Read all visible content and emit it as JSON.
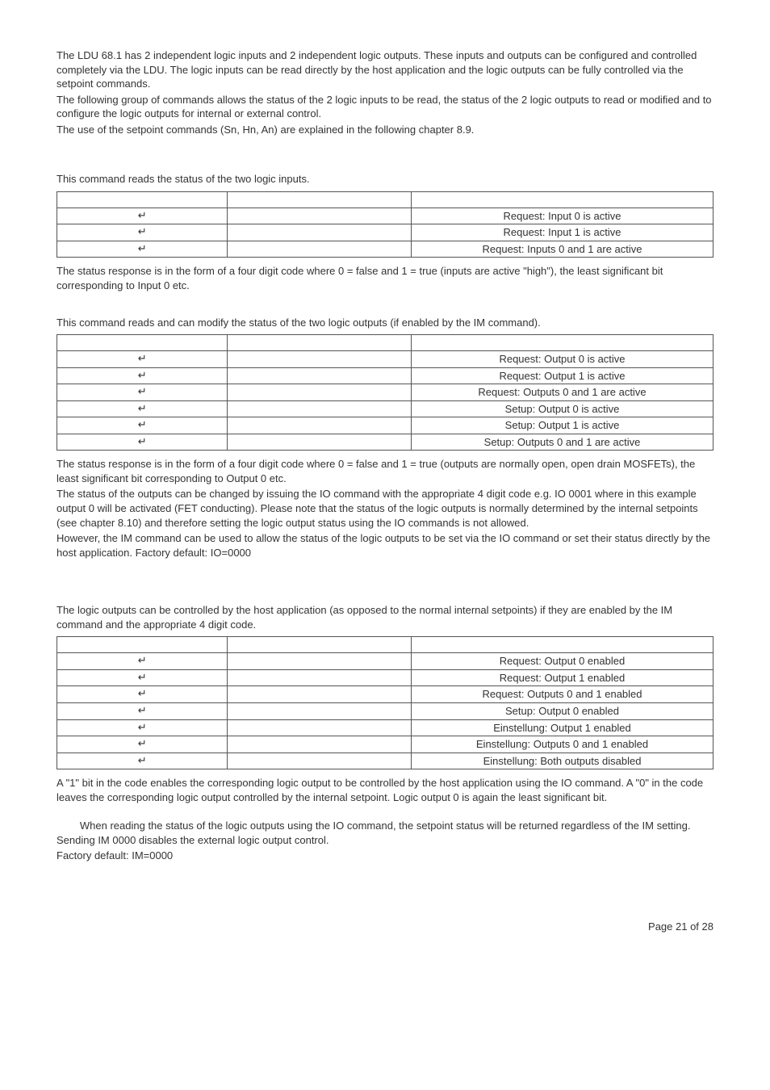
{
  "intro": {
    "p1": "The LDU 68.1 has 2 independent logic inputs and 2 independent logic outputs. These inputs and outputs can be configured and controlled completely via the LDU. The logic inputs can be read directly by the host application and the logic outputs can be fully controlled via the setpoint commands.",
    "p2": "The following group of commands allows the status of the 2 logic inputs to be read, the status of the 2 logic outputs to read or modified and to configure the logic outputs for internal or external control.",
    "p3": "The use of the setpoint commands (Sn, Hn, An) are explained in the following chapter 8.9."
  },
  "sec1": {
    "lead": "This command reads the status of the two logic inputs.",
    "rows": [
      {
        "c1": "↵",
        "c2": "",
        "c3": "Request: Input 0 is active"
      },
      {
        "c1": "↵",
        "c2": "",
        "c3": "Request: Input 1 is active"
      },
      {
        "c1": "↵",
        "c2": "",
        "c3": "Request: Inputs 0 and 1 are active"
      }
    ],
    "after": "The status response is in the form of a four digit code where 0 = false and 1 = true (inputs are active \"high\"), the least significant bit corresponding to Input 0 etc."
  },
  "sec2": {
    "lead": "This command reads and can modify the status of the two logic outputs (if enabled by the IM command).",
    "rows": [
      {
        "c1": "↵",
        "c2": "",
        "c3": "Request: Output 0 is active"
      },
      {
        "c1": "↵",
        "c2": "",
        "c3": "Request: Output 1 is active"
      },
      {
        "c1": "↵",
        "c2": "",
        "c3": "Request: Outputs 0 and 1 are active"
      },
      {
        "c1": "↵",
        "c2": "",
        "c3": "Setup: Output 0 is active"
      },
      {
        "c1": "↵",
        "c2": "",
        "c3": "Setup: Output 1 is active"
      },
      {
        "c1": "↵",
        "c2": "",
        "c3": "Setup: Outputs 0 and 1 are active"
      }
    ],
    "after1": "The status response is in the form of a four digit code where 0 = false and 1 = true (outputs are normally open, open drain MOSFETs), the least significant bit corresponding to Output 0 etc.",
    "after2": "The status of the outputs can be changed by issuing the IO command with the appropriate 4 digit code e.g. IO 0001 where in this example output 0 will be activated (FET conducting). Please note that the status of the logic outputs is normally determined by the internal setpoints (see chapter 8.10) and therefore setting the logic output status using the IO commands is not allowed.",
    "after3": "However, the IM command can be used to allow the status of the logic outputs to be set via the IO command or set their status directly by the host application. Factory default: IO=0000"
  },
  "sec3": {
    "lead": "The logic outputs can be controlled by the host application (as opposed to the normal internal setpoints) if they are enabled by the IM command and the appropriate 4 digit code.",
    "rows": [
      {
        "c1": "↵",
        "c2": "",
        "c3": "Request: Output 0 enabled"
      },
      {
        "c1": "↵",
        "c2": "",
        "c3": "Request: Output 1 enabled"
      },
      {
        "c1": "↵",
        "c2": "",
        "c3": "Request: Outputs 0 and 1 enabled"
      },
      {
        "c1": "↵",
        "c2": "",
        "c3": "Setup: Output 0 enabled"
      },
      {
        "c1": "↵",
        "c2": "",
        "c3": "Einstellung: Output 1 enabled"
      },
      {
        "c1": "↵",
        "c2": "",
        "c3": "Einstellung: Outputs 0 and 1 enabled"
      },
      {
        "c1": "↵",
        "c2": "",
        "c3": "Einstellung: Both outputs disabled"
      }
    ],
    "after1": "A \"1\" bit in the code enables the corresponding logic output to be controlled by the host application using the IO command. A \"0\" in the code leaves the corresponding logic output controlled by the internal setpoint. Logic output 0 is again the least significant bit.",
    "after2": "        When reading the status of the logic outputs using the IO command, the setpoint status will be returned regardless of the IM setting. Sending IM 0000 disables the external logic output control.",
    "after3": "Factory default: IM=0000"
  },
  "footer": "Page 21 of 28"
}
